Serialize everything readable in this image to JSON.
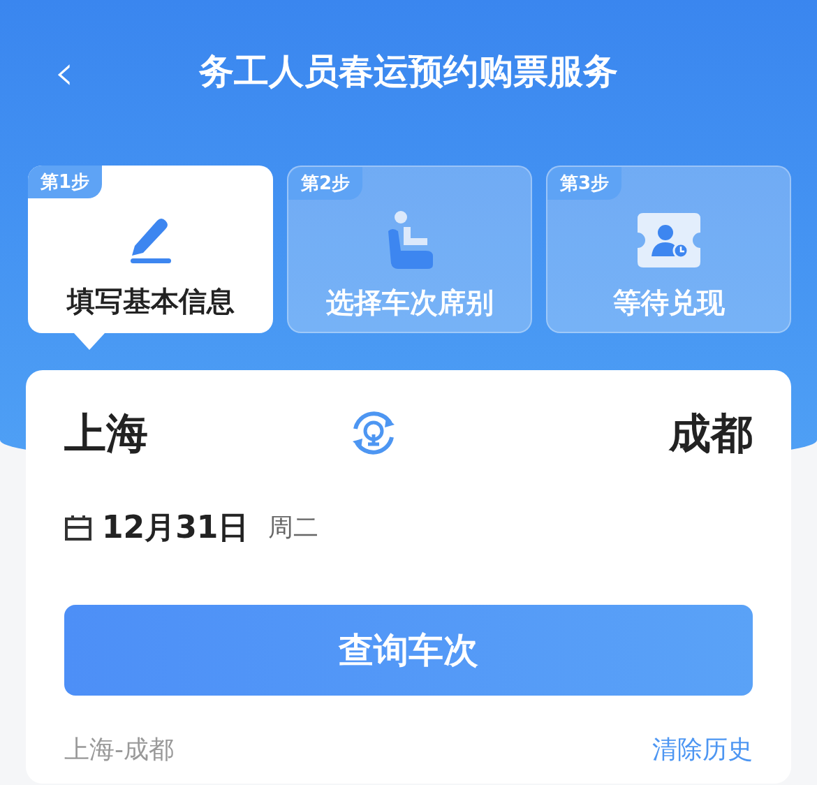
{
  "header": {
    "back_icon": "‹",
    "title": "务工人员春运预约购票服务"
  },
  "steps": [
    {
      "badge": "第1步",
      "label": "填写基本信息",
      "kind": "edit",
      "selected": true
    },
    {
      "badge": "第2步",
      "label": "选择车次席别",
      "kind": "seat",
      "selected": false
    },
    {
      "badge": "第3步",
      "label": "等待兑现",
      "kind": "ticket",
      "selected": false
    }
  ],
  "route": {
    "from": "上海",
    "to": "成都",
    "date": "12月31日",
    "weekday": "周二"
  },
  "search_button": "查询车次",
  "history": {
    "item": "上海-成都",
    "clear": "清除历史"
  }
}
